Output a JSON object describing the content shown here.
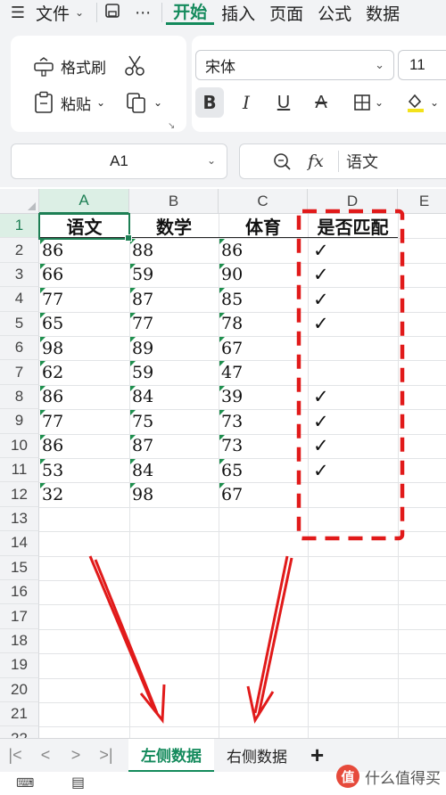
{
  "menubar": {
    "file_label": "文件",
    "tabs": [
      {
        "label": "开始",
        "active": true
      },
      {
        "label": "插入",
        "active": false
      },
      {
        "label": "页面",
        "active": false
      },
      {
        "label": "公式",
        "active": false
      },
      {
        "label": "数据",
        "active": false
      }
    ],
    "accent_color": "#148a5c"
  },
  "ribbon": {
    "format_painter_label": "格式刷",
    "paste_label": "粘贴",
    "font_name": "宋体",
    "font_size": "11",
    "bold_label": "B",
    "italic_label": "I",
    "underline_label": "U",
    "strike_label": "A"
  },
  "formula_bar": {
    "name_box": "A1",
    "formula_value": "语文"
  },
  "sheet": {
    "columns": [
      "A",
      "B",
      "C",
      "D",
      "E"
    ],
    "selected_column": "A",
    "rows": [
      "1",
      "2",
      "3",
      "4",
      "5",
      "6",
      "7",
      "8",
      "9",
      "10",
      "11",
      "12",
      "13",
      "14",
      "15",
      "16",
      "17",
      "18",
      "19",
      "20",
      "21",
      "22"
    ],
    "header_row": [
      "语文",
      "数学",
      "体育",
      "是否匹配"
    ],
    "data": [
      [
        "86",
        "88",
        "86",
        "✓"
      ],
      [
        "66",
        "59",
        "90",
        "✓"
      ],
      [
        "77",
        "87",
        "85",
        "✓"
      ],
      [
        "65",
        "77",
        "78",
        "✓"
      ],
      [
        "98",
        "89",
        "67",
        ""
      ],
      [
        "62",
        "59",
        "47",
        ""
      ],
      [
        "86",
        "84",
        "39",
        "✓"
      ],
      [
        "77",
        "75",
        "73",
        "✓"
      ],
      [
        "86",
        "87",
        "73",
        "✓"
      ],
      [
        "53",
        "84",
        "65",
        "✓"
      ],
      [
        "32",
        "98",
        "67",
        ""
      ]
    ],
    "annotation_color": "#e11a1a"
  },
  "sheet_tabs": {
    "tabs": [
      {
        "label": "左侧数据",
        "active": true
      },
      {
        "label": "右侧数据",
        "active": false
      }
    ],
    "add_label": "+"
  },
  "watermark": {
    "logo_text": "值",
    "text": "什么值得买"
  }
}
